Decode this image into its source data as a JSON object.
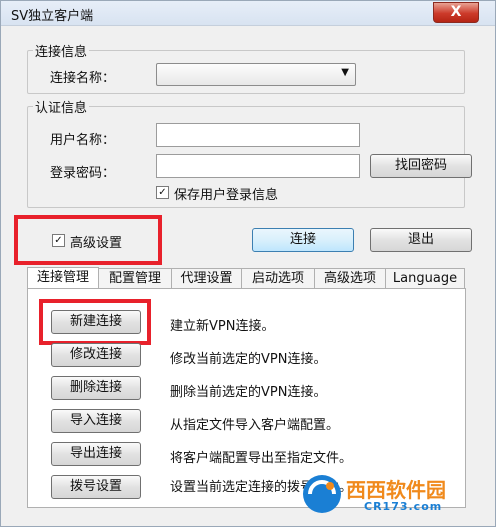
{
  "window": {
    "title": "SV独立客户端",
    "close_label": "X"
  },
  "connection_info": {
    "group_label": "连接信息",
    "name_label": "连接名称：",
    "name_value": ""
  },
  "auth_info": {
    "group_label": "认证信息",
    "username_label": "用户名称：",
    "username_value": "",
    "password_label": "登录密码：",
    "password_value": "",
    "recover_password_button": "找回密码",
    "save_login_label": "保存用户登录信息",
    "save_login_checked": true
  },
  "advanced": {
    "label": "高级设置",
    "checked": true
  },
  "actions": {
    "connect": "连接",
    "exit": "退出"
  },
  "tabs": [
    "连接管理",
    "配置管理",
    "代理设置",
    "启动选项",
    "高级选项",
    "Language"
  ],
  "active_tab": "连接管理",
  "connection_actions": [
    {
      "button": "新建连接",
      "desc": "建立新VPN连接。"
    },
    {
      "button": "修改连接",
      "desc": "修改当前选定的VPN连接。"
    },
    {
      "button": "删除连接",
      "desc": "删除当前选定的VPN连接。"
    },
    {
      "button": "导入连接",
      "desc": "从指定文件导入客户端配置。"
    },
    {
      "button": "导出连接",
      "desc": "将客户端配置导出至指定文件。"
    },
    {
      "button": "拨号设置",
      "desc": "设置当前选定连接的拨号属性。"
    }
  ],
  "watermark": {
    "brand": "西西软件园",
    "url": "CR173.com"
  },
  "colors": {
    "highlight": "#e8212b",
    "watermark_orange": "#f08a1c",
    "watermark_blue": "#1a7fd4"
  }
}
